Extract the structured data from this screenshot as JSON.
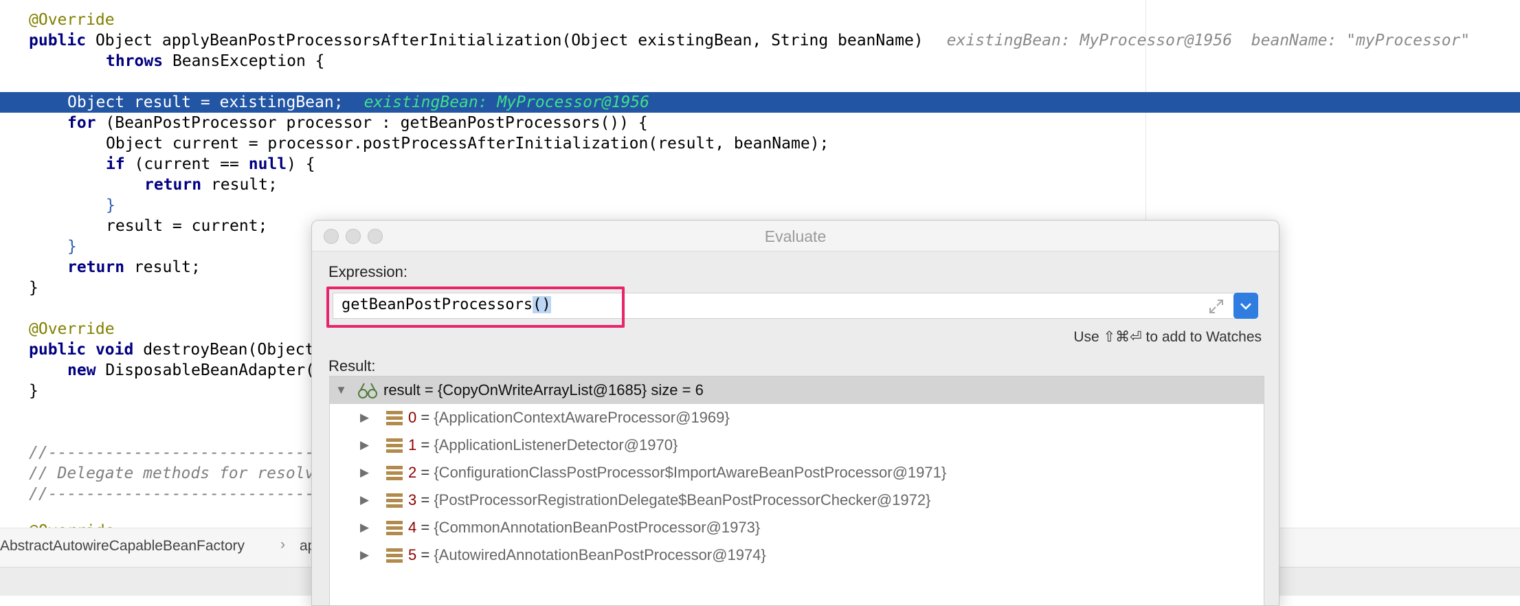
{
  "code": {
    "l1": "@Override",
    "l2_kw": "public",
    "l2_sig": " Object applyBeanPostProcessorsAfterInitialization(Object existingBean, String beanName)",
    "l2_hint": "existingBean: MyProcessor@1956  beanName: \"myProcessor\"",
    "l3_kw": "throws",
    "l3_rest": " BeansException {",
    "l5_code": "Object result = existingBean;",
    "l5_hint": "existingBean: MyProcessor@1956",
    "l6_kw": "for",
    "l6_rest": " (BeanPostProcessor processor : getBeanPostProcessors()) {",
    "l7": "Object current = processor.postProcessAfterInitialization(result, beanName);",
    "l8_kw": "if",
    "l8_a": " (current == ",
    "l8_null": "null",
    "l8_b": ") {",
    "l9_kw": "return",
    "l9_rest": " result;",
    "l10": "}",
    "l11": "result = current;",
    "l12": "}",
    "l13_kw": "return",
    "l13_rest": " result;",
    "l14": "}",
    "l16": "@Override",
    "l17_kw1": "public",
    "l17_kw2": "void",
    "l17_rest": " destroyBean(Object",
    "l18_kw": "new",
    "l18_rest": " DisposableBeanAdapter(",
    "l19": "}",
    "l21": "//------------------------------",
    "l22": "// Delegate methods for resolv",
    "l23": "//------------------------------",
    "l25": "@Override"
  },
  "breadcrumbs": {
    "class_name": "AbstractAutowireCapableBeanFactory",
    "separator": "›",
    "method": "ap"
  },
  "dialog": {
    "title": "Evaluate",
    "expression_label": "Expression:",
    "expression_main": "getBeanPostProcessors",
    "expression_parens": "()",
    "watch_hint": "Use ⇧⌘⏎ to add to Watches",
    "result_label": "Result:",
    "result_root": "result = {CopyOnWriteArrayList@1685}  size = 6",
    "items": [
      {
        "index": "0",
        "eq": " = ",
        "value": "{ApplicationContextAwareProcessor@1969}"
      },
      {
        "index": "1",
        "eq": " = ",
        "value": "{ApplicationListenerDetector@1970}"
      },
      {
        "index": "2",
        "eq": " = ",
        "value": "{ConfigurationClassPostProcessor$ImportAwareBeanPostProcessor@1971}"
      },
      {
        "index": "3",
        "eq": " = ",
        "value": "{PostProcessorRegistrationDelegate$BeanPostProcessorChecker@1972}"
      },
      {
        "index": "4",
        "eq": " = ",
        "value": "{CommonAnnotationBeanPostProcessor@1973}"
      },
      {
        "index": "5",
        "eq": " = ",
        "value": "{AutowiredAnnotationBeanPostProcessor@1974}"
      }
    ]
  },
  "colors": {
    "execution_line": "#2255a4",
    "highlight_box": "#e8246a",
    "dropdown_button": "#2f7de1"
  }
}
